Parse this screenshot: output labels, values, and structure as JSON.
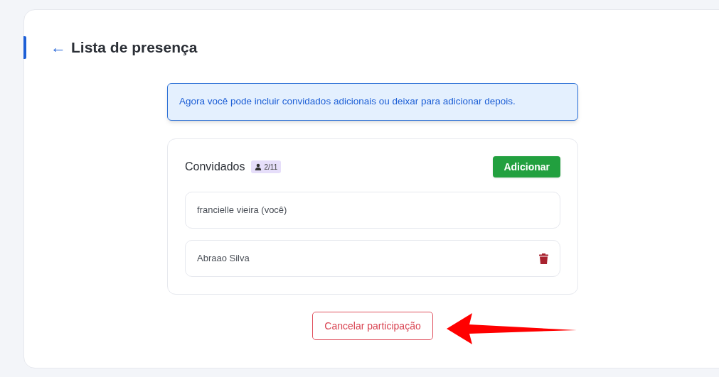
{
  "header": {
    "back_icon": "←",
    "title": "Lista de presença"
  },
  "info": "Agora você pode incluir convidados adicionais ou deixar para adicionar depois.",
  "guests": {
    "title": "Convidados",
    "count": "2/11",
    "add_button": "Adicionar",
    "items": [
      {
        "name": "francielle vieira (você)",
        "removable": false
      },
      {
        "name": "Abraao Silva",
        "removable": true
      }
    ]
  },
  "cancel_button": "Cancelar participação"
}
